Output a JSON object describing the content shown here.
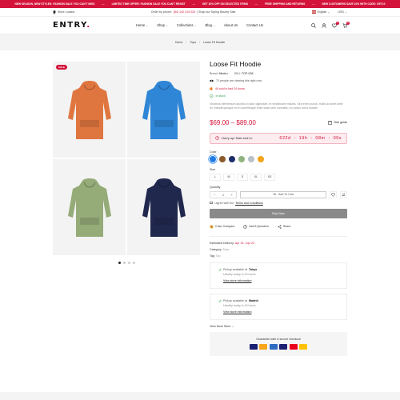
{
  "promo": [
    "NEW SEASON, NEW STYLES: FASHION SALE YOU CAN'T MISS",
    "LIMITED TIME OFFER: FASHION SALE YOU CAN'T RESIST",
    "GET 10% OFF ON SELECTED ITEMS",
    "FREE SHIPPING AND RETURNS",
    "NEW CUSTOMERS SAVE 10% WITH CODE: GET10"
  ],
  "topbar": {
    "store_locator": "Store Locator",
    "order_label": "Order by phone:",
    "phone": "(84) 142 414 025",
    "shop_sale": "| Shop our Spring Bounty Sale",
    "language": "English",
    "currency": "USD"
  },
  "header": {
    "logo": "ENTRY",
    "logo_dot": ".",
    "nav": [
      {
        "label": "Home",
        "caret": "⌄"
      },
      {
        "label": "Shop",
        "caret": "⌄"
      },
      {
        "label": "Collections",
        "caret": "⌄"
      },
      {
        "label": "Blog",
        "caret": "⌄"
      },
      {
        "label": "About Us",
        "caret": ""
      },
      {
        "label": "Contact Us",
        "caret": ""
      }
    ],
    "wishlist_count": "1",
    "cart_count": "0"
  },
  "breadcrumb": {
    "home": "Home",
    "sep": "/",
    "tops": "Tops",
    "current": "Loose Fit Hoodie"
  },
  "gallery": {
    "sale_badge": "SALE",
    "images": [
      {
        "color": "#e0763f",
        "name": "orange hoodie"
      },
      {
        "color": "#2f86d6",
        "name": "blue hoodie"
      },
      {
        "color": "#95ab78",
        "name": "sage hoodie"
      },
      {
        "color": "#21284e",
        "name": "navy hoodie"
      }
    ]
  },
  "product": {
    "title": "Loose Fit Hoodie",
    "brand_label": "Brand:",
    "brand": "Mindru",
    "sku_label": "SKU:",
    "sku": "TOP-006",
    "viewing": "73 people are viewing this right now",
    "sold": "44 sold in last 24 hours",
    "stock": "In stock",
    "description": "Vivamus elementum lacinia id dolor dignissim, et vestibulum mauris. Sed enim purus, mollis id amet ante mi, blandit quisque mi in scelerisque enim vitae sem convallis, eu luctus dolor sodale.",
    "price": "$69.00 – $89.00",
    "size_guide": "Size guide",
    "countdown_label": "Hurry up! Sale end in:",
    "timer": {
      "days": "622d",
      "hours": "19h",
      "minutes": "08m",
      "seconds": "09s",
      "colon": ":"
    },
    "color_label": "Color",
    "colors": [
      "#1e7ce6",
      "#8b5a2b",
      "#1d2c6b",
      "#8fb37e",
      "#b8c1c8",
      "#f3a51c"
    ],
    "size_label": "Size",
    "sizes": [
      "L",
      "M",
      "S",
      "XL",
      "XS"
    ],
    "quantity_label": "Quantity",
    "quantity": "1",
    "minus": "−",
    "plus": "+",
    "add_to_cart": "Add To Cart",
    "agree_text": "I agree with the",
    "terms": "Terms and Conditions",
    "buy_now": "Buy Now",
    "compare": "Color Compare",
    "ask": "Ask A Question",
    "share": "Share",
    "delivery_label": "Estimated Delivery:",
    "delivery": "Apr 15 - Apr 24",
    "category_label": "Category:",
    "category": "Tops",
    "tag_label": "Tag:",
    "tag": "Top",
    "pickups": [
      {
        "text": "Pickup available at",
        "store": "Tokyo",
        "ready": "Usually ready in 24 hours",
        "link": "View store information"
      },
      {
        "text": "Pickup available at",
        "store": "Madrid",
        "ready": "Usually ready in 24 hours",
        "link": "View store information"
      }
    ],
    "more_stores": "View More Store",
    "guarantee": "Guarantee safe & secure checkout",
    "payments": [
      "#1a1f71",
      "#f7a51b",
      "#2f6cc1",
      "#1a1f71",
      "#eb001b",
      "#ffc200"
    ]
  }
}
